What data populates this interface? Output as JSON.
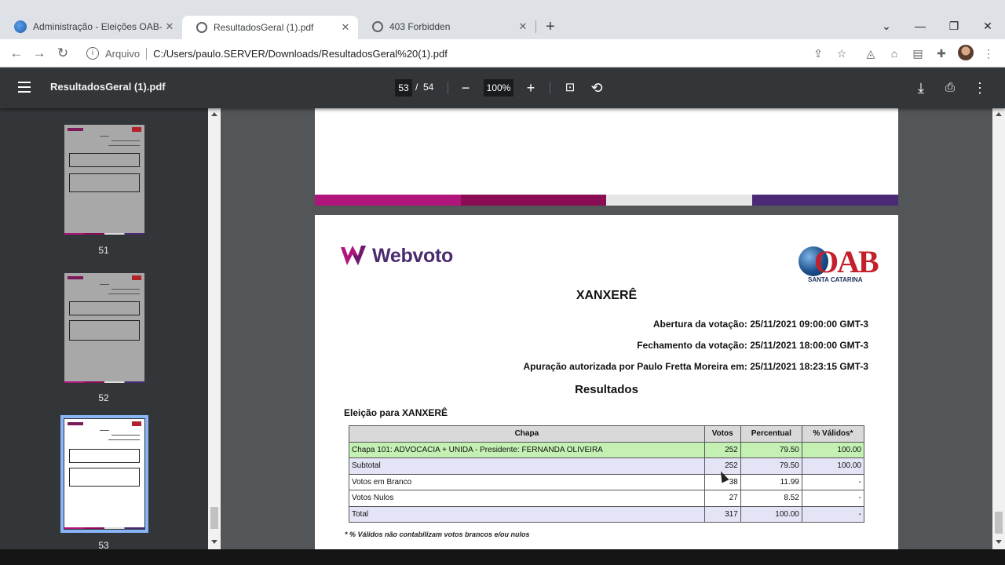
{
  "browser": {
    "tabs": [
      {
        "label": "Administração - Eleições OAB-SC",
        "active": false
      },
      {
        "label": "ResultadosGeral (1).pdf",
        "active": true
      },
      {
        "label": "403 Forbidden",
        "active": false
      }
    ],
    "address": {
      "scheme": "Arquivo",
      "url": "C:/Users/paulo.SERVER/Downloads/ResultadosGeral%20(1).pdf"
    }
  },
  "pdf_toolbar": {
    "filename": "ResultadosGeral (1).pdf",
    "current_page": "53",
    "page_separator": "/",
    "total_pages": "54",
    "zoom": "100%"
  },
  "thumbnails": [
    {
      "page": "51",
      "selected": false
    },
    {
      "page": "52",
      "selected": false
    },
    {
      "page": "53",
      "selected": true
    }
  ],
  "document": {
    "logo_text": "Webvoto",
    "oab_letters": "OAB",
    "oab_subtitle": "SANTA CATARINA",
    "title": "XANXERÊ",
    "opening": "Abertura da votação: 25/11/2021 09:00:00 GMT-3",
    "closing": "Fechamento da votação: 25/11/2021 18:00:00 GMT-3",
    "authorized": "Apuração autorizada por Paulo Fretta Moreira em: 25/11/2021 18:23:15 GMT-3",
    "results_heading": "Resultados",
    "election_label": "Eleição para XANXERÊ",
    "table": {
      "headers": {
        "chapa": "Chapa",
        "votos": "Votos",
        "percentual": "Percentual",
        "validos": "% Válidos*"
      },
      "rows": [
        {
          "chapa": "Chapa 101: ADVOCACIA + UNIDA - Presidente: FERNANDA OLIVEIRA",
          "votos": "252",
          "percentual": "79.50",
          "validos": "100.00"
        },
        {
          "chapa": "Subtotal",
          "votos": "252",
          "percentual": "79.50",
          "validos": "100.00"
        },
        {
          "chapa": "Votos em Branco",
          "votos": "38",
          "percentual": "11.99",
          "validos": "-"
        },
        {
          "chapa": "Votos Nulos",
          "votos": "27",
          "percentual": "8.52",
          "validos": "-"
        },
        {
          "chapa": "Total",
          "votos": "317",
          "percentual": "100.00",
          "validos": "-"
        }
      ]
    },
    "footnote": "* % Válidos não contabilizam votos brancos e/ou nulos"
  },
  "colors": {
    "pdf_toolbar_bg": "#323639",
    "viewer_bg": "#525659",
    "row_green": "#c4f0b4",
    "row_lavender": "#e4e4f7",
    "brand_magenta": "#b0157b",
    "brand_purple": "#4a2c6f",
    "oab_red": "#c3202c"
  }
}
